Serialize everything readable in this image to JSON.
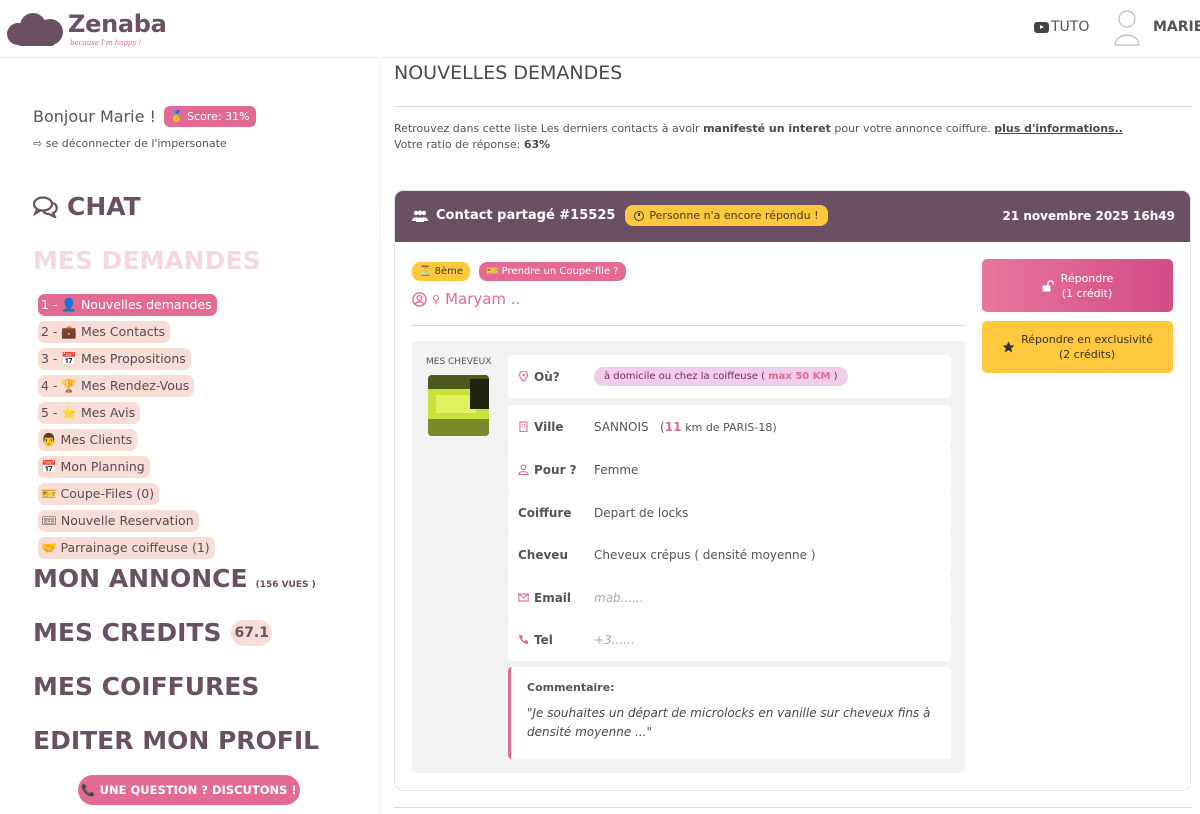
{
  "header": {
    "logo_text": "Zenaba",
    "logo_tagline": "because I'm happy !",
    "tuto_label": "TUTO",
    "user_name": "MARIE"
  },
  "sidebar": {
    "greeting": "Bonjour Marie !",
    "score_badge": "🥇 Score: 31%",
    "disconnect_label": "⇨ se déconnecter de l'impersonate",
    "chat_label": "CHAT",
    "demandes_label": "MES DEMANDES",
    "subnav": [
      {
        "label": "1 - 👤 Nouvelles demandes",
        "active": true
      },
      {
        "label": "2 - 💼 Mes Contacts"
      },
      {
        "label": "3 - 📅 Mes Propositions"
      },
      {
        "label": "4 - 🏆 Mes Rendez-Vous"
      },
      {
        "label": "5 - ⭐ Mes Avis"
      },
      {
        "label": "👨 Mes Clients"
      },
      {
        "label": "📅 Mon Planning"
      },
      {
        "label": "🎫 Coupe-Files (0)"
      },
      {
        "label": "🎟 Nouvelle Reservation"
      },
      {
        "label": "🤝 Parrainage coiffeuse (1)"
      }
    ],
    "annonce_label": "MON ANNONCE",
    "annonce_vues": "(156 VUES )",
    "credits_label": "MES CREDITS",
    "credits_value": "67.1",
    "coiffures_label": "MES COIFFURES",
    "profil_label": "EDITER MON PROFIL",
    "question_button": "📞 UNE QUESTION ? DISCUTONS !"
  },
  "main": {
    "page_title": "NOUVELLES DEMANDES",
    "intro_1": "Retrouvez dans cette liste Les derniers contacts à avoir ",
    "intro_bold": "manifesté un interet",
    "intro_2": " pour votre annonce coiffure. ",
    "intro_link": "plus d'informations..",
    "ratio_label": "Votre ratio de réponse: ",
    "ratio_value": "63%"
  },
  "card": {
    "contact_title": "Contact partagé #15525",
    "status_badge": "Personne n'a encore répondu !",
    "date": "21 novembre 2025 16h49",
    "tag_rank": "⏳ 8ème",
    "tag_coupe": "🎫 Prendre un Coupe-file ?",
    "client_gender": "♀",
    "client_name": "Maryam ..",
    "cheveux_label": "MES CHEVEUX",
    "rows": {
      "ou_label": "Où?",
      "ou_value": "à domicile ou chez la coiffeuse (",
      "ou_max": "max 50 KM",
      "ou_close": ")",
      "ville_label": "Ville",
      "ville_value": "SANNOIS",
      "ville_km": "11",
      "ville_suffix": "km de PARIS-18)",
      "pour_label": "Pour ?",
      "pour_value": "Femme",
      "coiffure_label": "Coiffure",
      "coiffure_value": "Depart de locks",
      "cheveu_label": "Cheveu",
      "cheveu_value": "Cheveux crépus ( densité moyenne )",
      "email_label": "Email",
      "email_value": "mab......",
      "tel_label": "Tel",
      "tel_value": "+3......"
    },
    "comment_label": "Commentaire:",
    "comment_text": "\"Je souhaites un départ de microlocks en vanille sur cheveux fins à densité moyenne ...\"",
    "btn_repondre_1": "Répondre",
    "btn_repondre_2": "(1 crédit)",
    "btn_exclu_1": "Répondre en exclusivité",
    "btn_exclu_2": "(2 crédits)"
  },
  "colors": {
    "brand_plum": "#6b5063",
    "accent_pink": "#e36a94",
    "accent_yellow": "#ffc83d"
  }
}
